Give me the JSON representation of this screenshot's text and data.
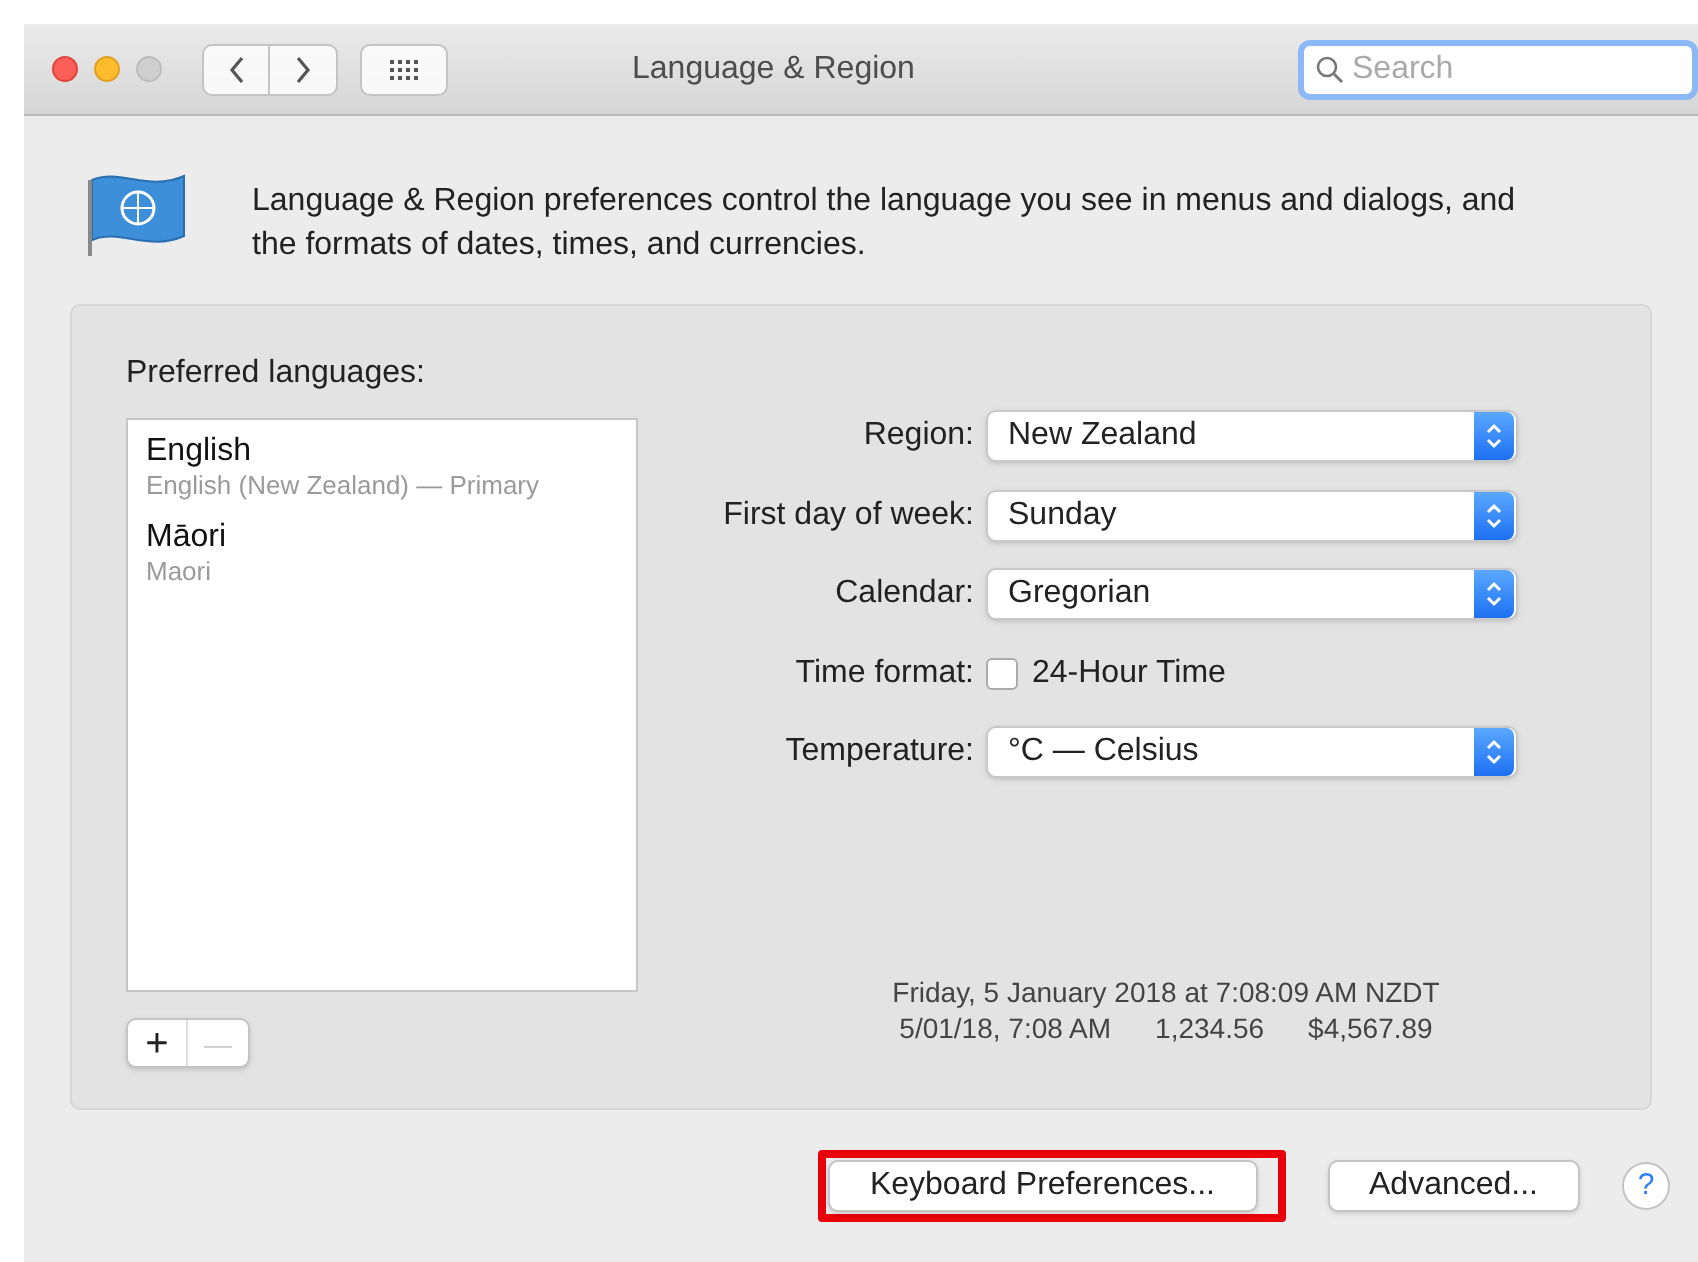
{
  "window": {
    "title": "Language & Region"
  },
  "search": {
    "placeholder": "Search"
  },
  "intro": "Language & Region preferences control the language you see in menus and dialogs, and the formats of dates, times, and currencies.",
  "preferred_languages": {
    "label": "Preferred languages:",
    "items": [
      {
        "name": "English",
        "detail": "English (New Zealand) — Primary"
      },
      {
        "name": "Māori",
        "detail": "Maori"
      }
    ],
    "add": "+",
    "remove": "—"
  },
  "settings": [
    {
      "kind": "select",
      "label": "Region:",
      "value": "New Zealand"
    },
    {
      "kind": "select",
      "label": "First day of week:",
      "value": "Sunday"
    },
    {
      "kind": "select",
      "label": "Calendar:",
      "value": "Gregorian"
    },
    {
      "kind": "checkbox",
      "label": "Time format:",
      "value": "24-Hour Time",
      "checked": false
    },
    {
      "kind": "select",
      "label": "Temperature:",
      "value": "°C — Celsius"
    }
  ],
  "sample": {
    "line_1": "Friday, 5 January 2018 at 7:08:09 AM NZDT",
    "line_2": [
      "5/01/18, 7:08 AM",
      "1,234.56",
      "$4,567.89"
    ]
  },
  "buttons": [
    {
      "label": "Keyboard Preferences...",
      "highlighted": true
    },
    {
      "label": "Advanced...",
      "highlighted": false
    }
  ],
  "help": "?"
}
